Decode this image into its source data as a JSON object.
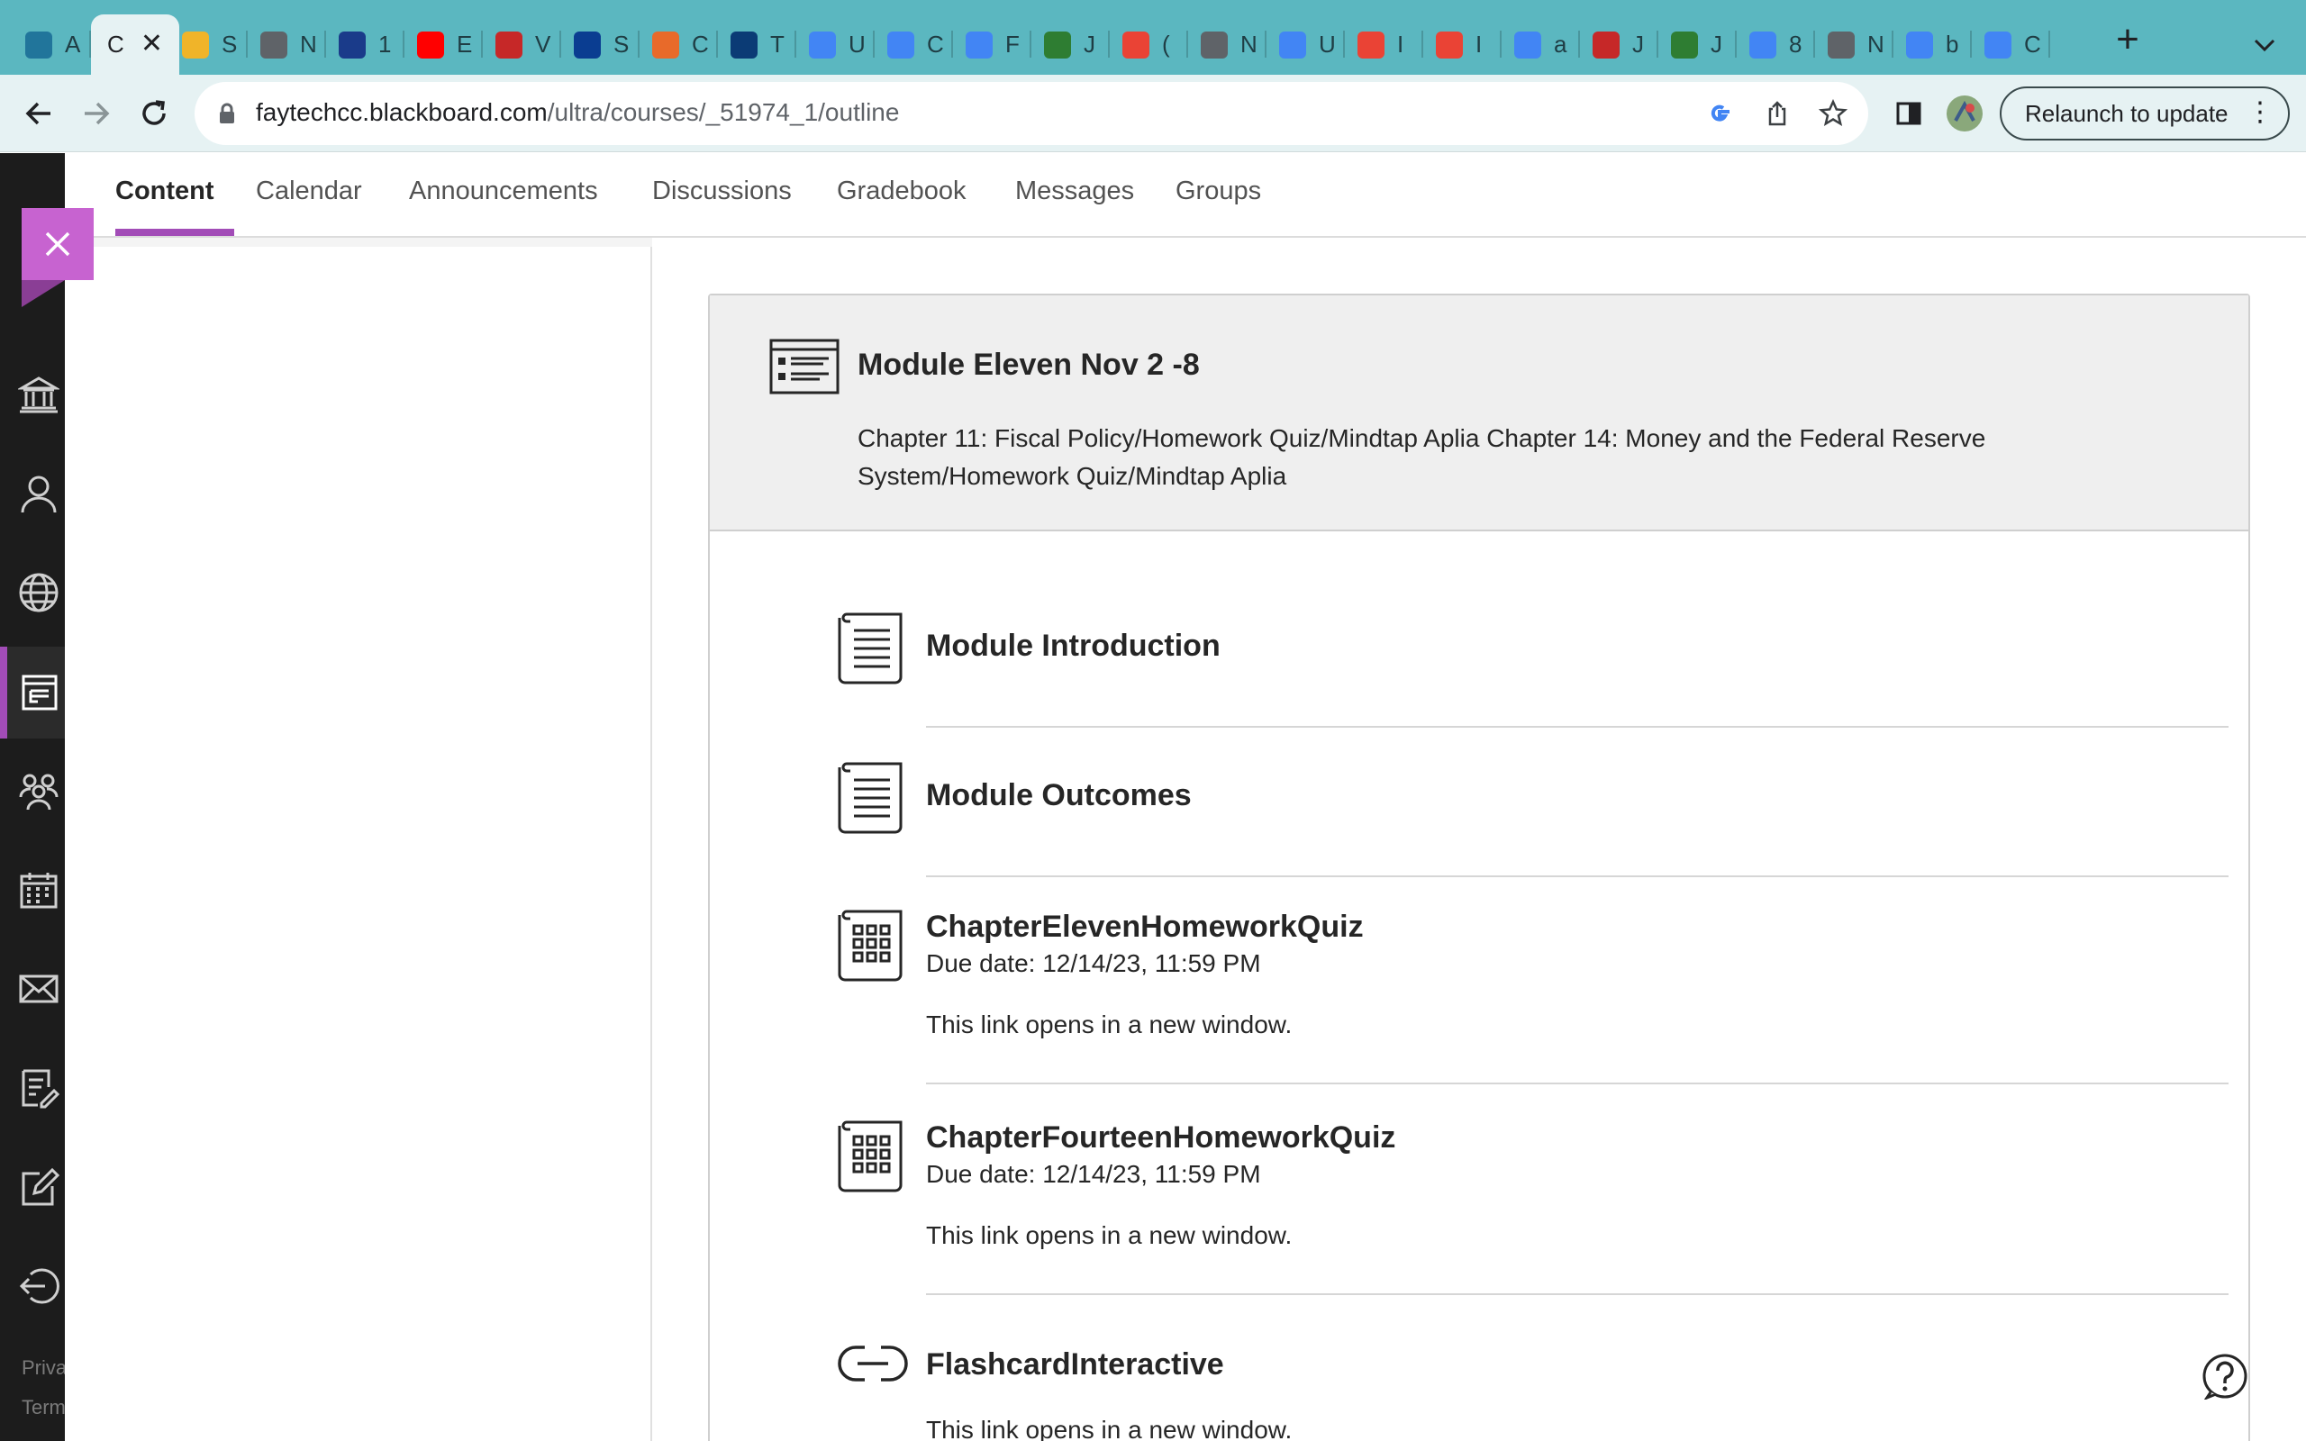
{
  "browser": {
    "tabs": [
      {
        "title": "A",
        "icon": "wordpress-icon",
        "color": "#21759b"
      },
      {
        "title": "C",
        "icon": "blackboard-icon",
        "active": true
      },
      {
        "title": "S",
        "icon": "ftcc-icon",
        "color": "#f0b429"
      },
      {
        "title": "N",
        "icon": "globe-icon",
        "color": "#5f6368"
      },
      {
        "title": "1",
        "icon": "diamond-icon",
        "color": "#1a3b8a"
      },
      {
        "title": "E",
        "icon": "youtube-icon",
        "color": "#ff0000"
      },
      {
        "title": "V",
        "icon": "stack-icon",
        "color": "#c62828"
      },
      {
        "title": "S",
        "icon": "circle-logo-icon",
        "color": "#0a3d91"
      },
      {
        "title": "C",
        "icon": "flower-icon",
        "color": "#e86a2a"
      },
      {
        "title": "T",
        "icon": "sis-icon",
        "color": "#0b3b75"
      },
      {
        "title": "U",
        "icon": "docs-icon",
        "color": "#4285f4"
      },
      {
        "title": "C",
        "icon": "docs-icon",
        "color": "#4285f4"
      },
      {
        "title": "F",
        "icon": "docs-icon",
        "color": "#4285f4"
      },
      {
        "title": "J",
        "icon": "flag-icon",
        "color": "#2e7d32"
      },
      {
        "title": "(",
        "icon": "gmail-icon",
        "color": "#ea4335"
      },
      {
        "title": "N",
        "icon": "chrome-icon",
        "color": "#5f6368"
      },
      {
        "title": "U",
        "icon": "docs-icon",
        "color": "#4285f4"
      },
      {
        "title": "I",
        "icon": "gmail-icon",
        "color": "#ea4335"
      },
      {
        "title": "I",
        "icon": "gmail-icon",
        "color": "#ea4335"
      },
      {
        "title": "a",
        "icon": "docs-icon",
        "color": "#4285f4"
      },
      {
        "title": "J",
        "icon": "book-icon",
        "color": "#c62828"
      },
      {
        "title": "J",
        "icon": "flag-icon",
        "color": "#2e7d32"
      },
      {
        "title": "8",
        "icon": "google-icon",
        "color": "#4285f4"
      },
      {
        "title": "N",
        "icon": "chrome-icon",
        "color": "#5f6368"
      },
      {
        "title": "b",
        "icon": "google-icon",
        "color": "#4285f4"
      },
      {
        "title": "C",
        "icon": "key-icon",
        "color": "#4285f4"
      }
    ],
    "url_host": "faytechcc.blackboard.com",
    "url_path": "/ultra/courses/_51974_1/outline",
    "relaunch_label": "Relaunch to update"
  },
  "rail": {
    "items": [
      "institution-icon",
      "profile-icon",
      "globe-icon",
      "courses-icon",
      "groups-icon",
      "calendar-icon",
      "messages-icon",
      "grades-icon",
      "tools-icon",
      "sign-out-icon"
    ],
    "footer": [
      "Priva",
      "Term"
    ]
  },
  "course_nav": {
    "items": [
      "Content",
      "Calendar",
      "Announcements",
      "Discussions",
      "Gradebook",
      "Messages",
      "Groups"
    ],
    "active": "Content"
  },
  "module": {
    "title": "Module Eleven Nov 2 -8",
    "description": "Chapter 11: Fiscal Policy/Homework Quiz/Mindtap Aplia  Chapter 14: Money and the Federal Reserve System/Homework Quiz/Mindtap Aplia",
    "items": [
      {
        "title": "Module Introduction",
        "icon": "document-icon"
      },
      {
        "title": "Module Outcomes",
        "icon": "document-icon"
      },
      {
        "title": "ChapterElevenHomeworkQuiz",
        "icon": "assessment-icon",
        "due": "Due date: 12/14/23, 11:59 PM",
        "note": "This link opens in a new window."
      },
      {
        "title": "ChapterFourteenHomeworkQuiz",
        "icon": "assessment-icon",
        "due": "Due date: 12/14/23, 11:59 PM",
        "note": "This link opens in a new window."
      },
      {
        "title": "FlashcardInteractive",
        "icon": "link-icon",
        "note": "This link opens in a new window."
      }
    ]
  },
  "colors": {
    "accent": "#a24cb7",
    "close_button": "#c763d0",
    "tabstrip": "#5bb7c0",
    "rail": "#1c1c1c"
  }
}
